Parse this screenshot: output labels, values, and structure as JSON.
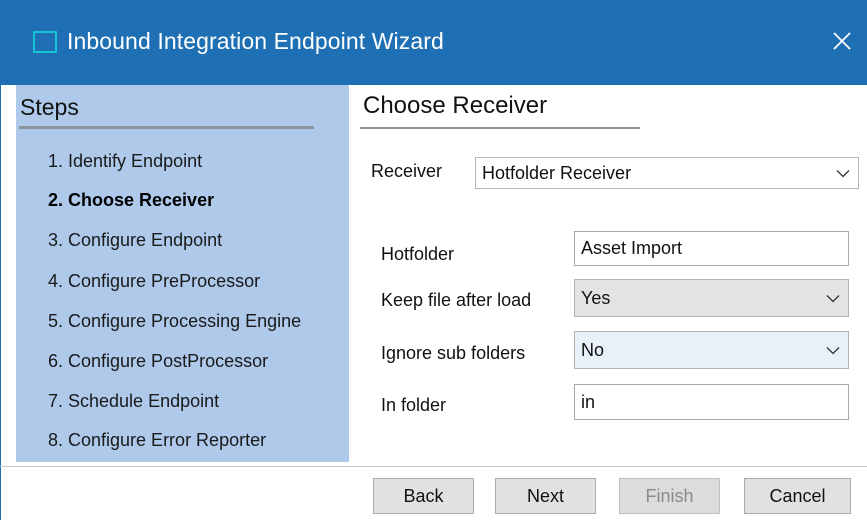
{
  "window": {
    "title": "Inbound Integration Endpoint Wizard",
    "close_glyph": "✕"
  },
  "steps": {
    "title": "Steps",
    "items": [
      {
        "label": "1. Identify Endpoint",
        "current": false
      },
      {
        "label": "2. Choose Receiver",
        "current": true
      },
      {
        "label": "3. Configure Endpoint",
        "current": false
      },
      {
        "label": "4. Configure PreProcessor",
        "current": false
      },
      {
        "label": "5. Configure Processing Engine",
        "current": false
      },
      {
        "label": "6. Configure PostProcessor",
        "current": false
      },
      {
        "label": "7. Schedule Endpoint",
        "current": false
      },
      {
        "label": "8. Configure Error Reporter",
        "current": false
      }
    ]
  },
  "main": {
    "section_title": "Choose Receiver",
    "receiver": {
      "label": "Receiver",
      "value": "Hotfolder Receiver"
    },
    "fields": {
      "hotfolder": {
        "label": "Hotfolder",
        "value": "Asset Import"
      },
      "keep_file": {
        "label": "Keep file after load",
        "value": "Yes"
      },
      "ignore_sub": {
        "label": "Ignore sub folders",
        "value": "No"
      },
      "in_folder": {
        "label": "In folder",
        "value": "in"
      }
    }
  },
  "buttons": {
    "back": "Back",
    "next": "Next",
    "finish": "Finish",
    "cancel": "Cancel"
  },
  "colors": {
    "titlebar": "#1f6fb5",
    "steps_panel": "#aec9ea",
    "app_icon": "#19c3d6"
  },
  "icons": {
    "app": "window-icon",
    "close": "close-icon",
    "dropdown": "chevron-down-icon"
  }
}
